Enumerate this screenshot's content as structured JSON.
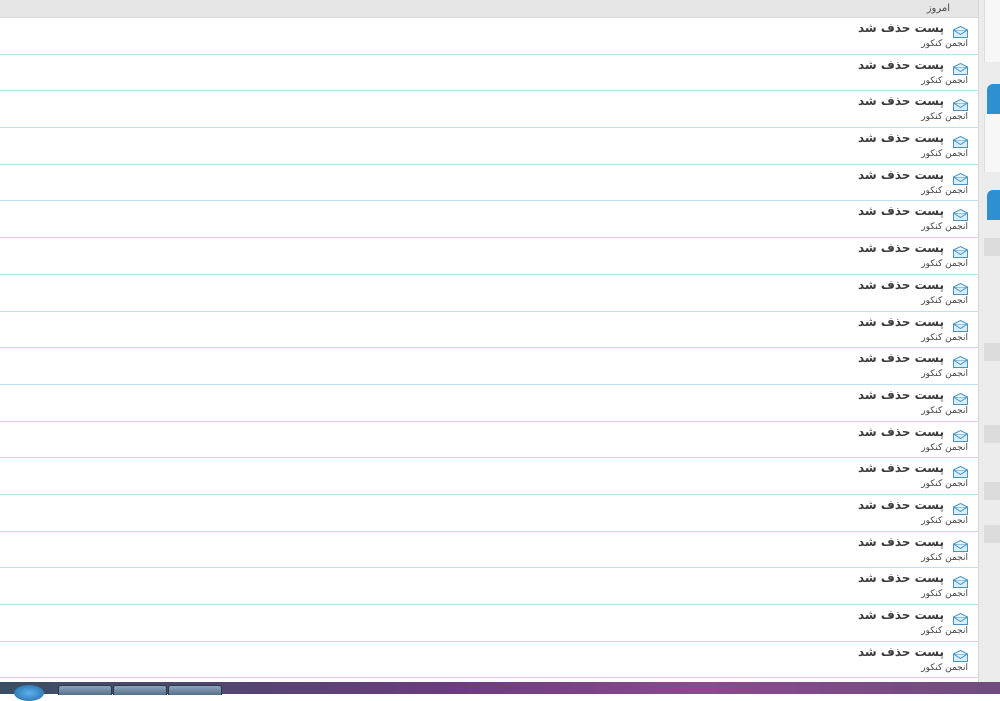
{
  "section": {
    "label": "امروز"
  },
  "rows": [
    {
      "title": "پست حذف شد",
      "subtitle": "انجمن کنکور"
    },
    {
      "title": "پست حذف شد",
      "subtitle": "انجمن کنکور"
    },
    {
      "title": "پست حذف شد",
      "subtitle": "انجمن کنکور"
    },
    {
      "title": "پست حذف شد",
      "subtitle": "انجمن کنکور"
    },
    {
      "title": "پست حذف شد",
      "subtitle": "انجمن کنکور"
    },
    {
      "title": "پست حذف شد",
      "subtitle": "انجمن کنکور"
    },
    {
      "title": "پست حذف شد",
      "subtitle": "انجمن کنکور"
    },
    {
      "title": "پست حذف شد",
      "subtitle": "انجمن کنکور"
    },
    {
      "title": "پست حذف شد",
      "subtitle": "انجمن کنکور"
    },
    {
      "title": "پست حذف شد",
      "subtitle": "انجمن کنکور"
    },
    {
      "title": "پست حذف شد",
      "subtitle": "انجمن کنکور"
    },
    {
      "title": "پست حذف شد",
      "subtitle": "انجمن کنکور"
    },
    {
      "title": "پست حذف شد",
      "subtitle": "انجمن کنکور"
    },
    {
      "title": "پست حذف شد",
      "subtitle": "انجمن کنکور"
    },
    {
      "title": "پست حذف شد",
      "subtitle": "انجمن کنکور"
    },
    {
      "title": "پست حذف شد",
      "subtitle": "انجمن کنکور"
    },
    {
      "title": "پست حذف شد",
      "subtitle": "انجمن کنکور"
    },
    {
      "title": "پست حذف شد",
      "subtitle": "انجمن کنکور"
    }
  ],
  "icons": {
    "row_icon": "envelope-open-icon"
  },
  "colors": {
    "row_divider": "#bfe0ef",
    "accent": "#2e8fd1",
    "header_bg": "#e6e6e6"
  }
}
